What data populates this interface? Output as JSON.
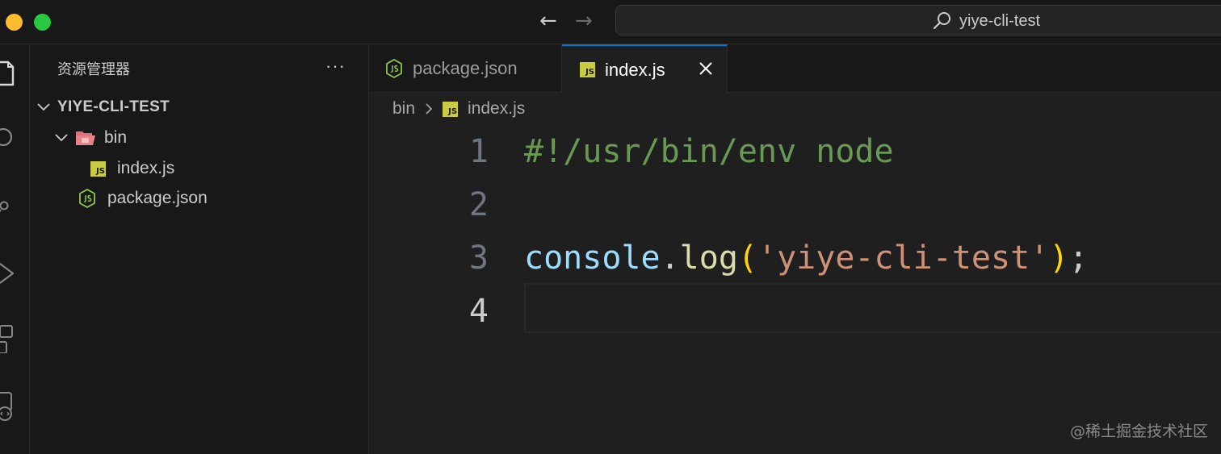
{
  "window": {
    "search_text": "yiye-cli-test"
  },
  "navigation": {
    "back_glyph": "←",
    "forward_glyph": "→"
  },
  "activity_bar": {
    "icons": [
      "explorer-icon",
      "search-icon",
      "source-control-icon",
      "run-debug-icon",
      "extensions-icon",
      "remote-explorer-icon"
    ]
  },
  "sidebar": {
    "title": "资源管理器",
    "more_glyph": "···",
    "project": "YIYE-CLI-TEST",
    "tree": [
      {
        "label": "bin",
        "type": "folder",
        "expanded": true
      },
      {
        "label": "index.js",
        "type": "js-file"
      },
      {
        "label": "package.json",
        "type": "node-file"
      }
    ]
  },
  "tabs": [
    {
      "label": "package.json",
      "active": false,
      "icon": "nodejs-icon"
    },
    {
      "label": "index.js",
      "active": true,
      "icon": "js-icon"
    }
  ],
  "js_badge_text": "JS",
  "breadcrumb": {
    "folder": "bin",
    "file": "index.js"
  },
  "editor": {
    "lines": [
      {
        "number": "1",
        "tokens": [
          {
            "t": "comment",
            "v": "#!/usr/bin/env node"
          }
        ]
      },
      {
        "number": "2",
        "tokens": []
      },
      {
        "number": "3",
        "tokens": [
          {
            "t": "ident",
            "v": "console"
          },
          {
            "t": "punct",
            "v": "."
          },
          {
            "t": "func",
            "v": "log"
          },
          {
            "t": "paren",
            "v": "("
          },
          {
            "t": "string",
            "v": "'yiye-cli-test'"
          },
          {
            "t": "paren",
            "v": ")"
          },
          {
            "t": "punct",
            "v": ";"
          }
        ]
      },
      {
        "number": "4",
        "tokens": []
      }
    ],
    "active_line": "4"
  },
  "watermark": "@稀土掘金技术社区",
  "colors": {
    "accent": "#0078d4",
    "comment": "#6a9955",
    "identifier": "#9cdcfe",
    "function": "#dcdcaa",
    "bracket": "#ffd700",
    "string": "#ce9178",
    "js_badge": "#cbcb41",
    "node_green": "#8cc84b",
    "folder_red": "#e06c75"
  }
}
